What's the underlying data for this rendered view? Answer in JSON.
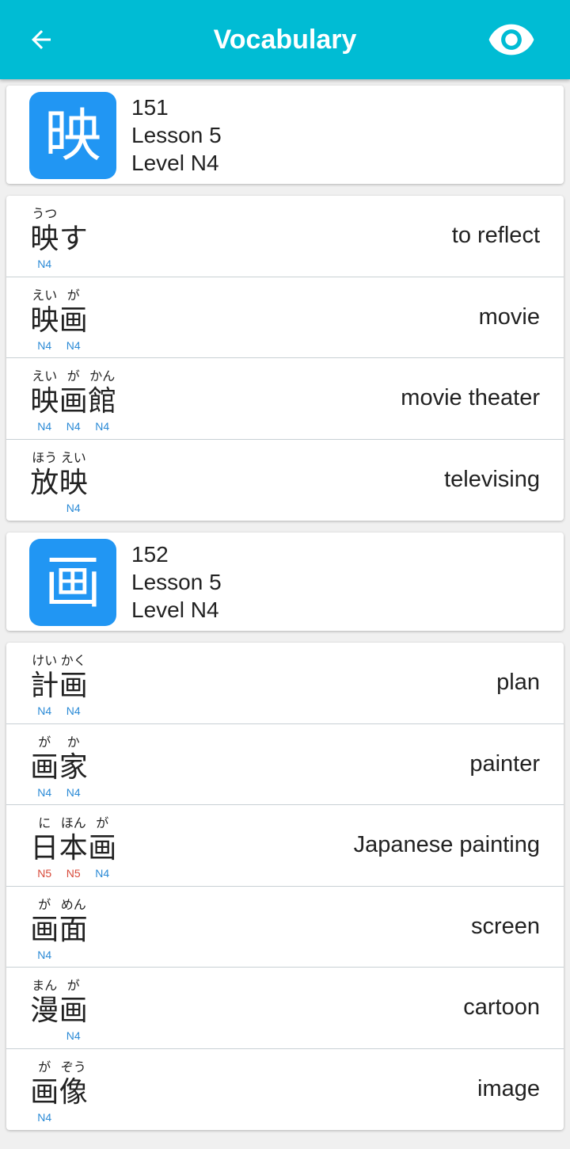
{
  "app_bar": {
    "title": "Vocabulary",
    "back_icon": "arrow-back-icon",
    "visibility_icon": "eye-icon",
    "color": "#00bcd4"
  },
  "sections": [
    {
      "kanji": "映",
      "number": "151",
      "lesson": "Lesson 5",
      "level": "Level N4",
      "words": [
        {
          "meaning": "to reflect",
          "chars": [
            {
              "c": "映",
              "furi": "うつ",
              "lvl": "N4"
            },
            {
              "c": "す",
              "furi": "",
              "lvl": ""
            }
          ]
        },
        {
          "meaning": "movie",
          "chars": [
            {
              "c": "映",
              "furi": "えい",
              "lvl": "N4"
            },
            {
              "c": "画",
              "furi": "が",
              "lvl": "N4"
            }
          ]
        },
        {
          "meaning": "movie theater",
          "chars": [
            {
              "c": "映",
              "furi": "えい",
              "lvl": "N4"
            },
            {
              "c": "画",
              "furi": "が",
              "lvl": "N4"
            },
            {
              "c": "館",
              "furi": "かん",
              "lvl": "N4"
            }
          ]
        },
        {
          "meaning": "televising",
          "chars": [
            {
              "c": "放",
              "furi": "ほう",
              "lvl": ""
            },
            {
              "c": "映",
              "furi": "えい",
              "lvl": "N4"
            }
          ]
        }
      ]
    },
    {
      "kanji": "画",
      "number": "152",
      "lesson": "Lesson 5",
      "level": "Level N4",
      "words": [
        {
          "meaning": "plan",
          "chars": [
            {
              "c": "計",
              "furi": "けい",
              "lvl": "N4"
            },
            {
              "c": "画",
              "furi": "かく",
              "lvl": "N4"
            }
          ]
        },
        {
          "meaning": "painter",
          "chars": [
            {
              "c": "画",
              "furi": "が",
              "lvl": "N4"
            },
            {
              "c": "家",
              "furi": "か",
              "lvl": "N4"
            }
          ]
        },
        {
          "meaning": "Japanese painting",
          "chars": [
            {
              "c": "日",
              "furi": "に",
              "lvl": "N5"
            },
            {
              "c": "本",
              "furi": "ほん",
              "lvl": "N5"
            },
            {
              "c": "画",
              "furi": "が",
              "lvl": "N4"
            }
          ]
        },
        {
          "meaning": "screen",
          "chars": [
            {
              "c": "画",
              "furi": "が",
              "lvl": "N4"
            },
            {
              "c": "面",
              "furi": "めん",
              "lvl": ""
            }
          ]
        },
        {
          "meaning": "cartoon",
          "chars": [
            {
              "c": "漫",
              "furi": "まん",
              "lvl": ""
            },
            {
              "c": "画",
              "furi": "が",
              "lvl": "N4"
            }
          ]
        },
        {
          "meaning": "image",
          "chars": [
            {
              "c": "画",
              "furi": "が",
              "lvl": "N4"
            },
            {
              "c": "像",
              "furi": "ぞう",
              "lvl": ""
            }
          ]
        }
      ]
    }
  ]
}
